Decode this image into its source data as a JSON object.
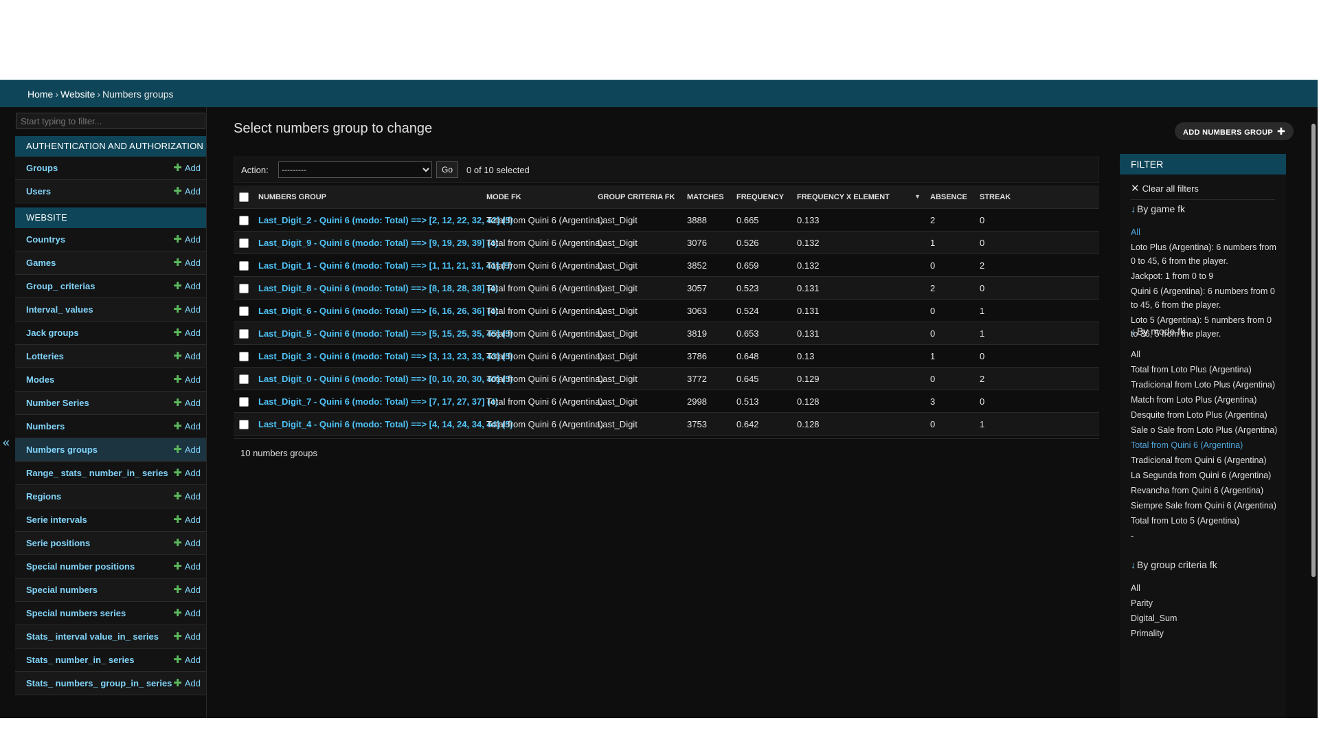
{
  "breadcrumbs": {
    "home": "Home",
    "website": "Website",
    "current": "Numbers groups",
    "sep": "›"
  },
  "sidebar": {
    "filter_placeholder": "Start typing to filter...",
    "modules": [
      {
        "caption": "AUTHENTICATION AND AUTHORIZATION",
        "items": [
          {
            "label": "Groups",
            "add": "Add"
          },
          {
            "label": "Users",
            "add": "Add"
          }
        ]
      },
      {
        "caption": "WEBSITE",
        "items": [
          {
            "label": "Countrys",
            "add": "Add"
          },
          {
            "label": "Games",
            "add": "Add"
          },
          {
            "label": "Group_ criterias",
            "add": "Add"
          },
          {
            "label": "Interval_ values",
            "add": "Add"
          },
          {
            "label": "Jack groups",
            "add": "Add"
          },
          {
            "label": "Lotteries",
            "add": "Add"
          },
          {
            "label": "Modes",
            "add": "Add"
          },
          {
            "label": "Number Series",
            "add": "Add"
          },
          {
            "label": "Numbers",
            "add": "Add"
          },
          {
            "label": "Numbers groups",
            "add": "Add"
          },
          {
            "label": "Range_ stats_ number_in_ series",
            "add": "Add"
          },
          {
            "label": "Regions",
            "add": "Add"
          },
          {
            "label": "Serie intervals",
            "add": "Add"
          },
          {
            "label": "Serie positions",
            "add": "Add"
          },
          {
            "label": "Special number positions",
            "add": "Add"
          },
          {
            "label": "Special numbers",
            "add": "Add"
          },
          {
            "label": "Special numbers series",
            "add": "Add"
          },
          {
            "label": "Stats_ interval value_in_ series",
            "add": "Add"
          },
          {
            "label": "Stats_ number_in_ series",
            "add": "Add"
          },
          {
            "label": "Stats_ numbers_ group_in_ series",
            "add": "Add"
          }
        ]
      }
    ]
  },
  "main": {
    "title": "Select numbers group to change",
    "add_button": "ADD NUMBERS GROUP",
    "action_label": "Action:",
    "action_selected": "---------",
    "go_label": "Go",
    "selected_counter": "0 of 10 selected",
    "columns": [
      "NUMBERS GROUP",
      "MODE FK",
      "GROUP CRITERIA FK",
      "MATCHES",
      "FREQUENCY",
      "FREQUENCY X ELEMENT",
      "ABSENCE",
      "STREAK"
    ],
    "rows": [
      [
        "Last_Digit_2 - Quini 6 (modo: Total) ==> [2, 12, 22, 32, 42] (5)",
        "Total from Quini 6 (Argentina)",
        "Last_Digit",
        "3888",
        "0.665",
        "0.133",
        "2",
        "0"
      ],
      [
        "Last_Digit_9 - Quini 6 (modo: Total) ==> [9, 19, 29, 39] (4)",
        "Total from Quini 6 (Argentina)",
        "Last_Digit",
        "3076",
        "0.526",
        "0.132",
        "1",
        "0"
      ],
      [
        "Last_Digit_1 - Quini 6 (modo: Total) ==> [1, 11, 21, 31, 41] (5)",
        "Total from Quini 6 (Argentina)",
        "Last_Digit",
        "3852",
        "0.659",
        "0.132",
        "0",
        "2"
      ],
      [
        "Last_Digit_8 - Quini 6 (modo: Total) ==> [8, 18, 28, 38] (4)",
        "Total from Quini 6 (Argentina)",
        "Last_Digit",
        "3057",
        "0.523",
        "0.131",
        "2",
        "0"
      ],
      [
        "Last_Digit_6 - Quini 6 (modo: Total) ==> [6, 16, 26, 36] (4)",
        "Total from Quini 6 (Argentina)",
        "Last_Digit",
        "3063",
        "0.524",
        "0.131",
        "0",
        "1"
      ],
      [
        "Last_Digit_5 - Quini 6 (modo: Total) ==> [5, 15, 25, 35, 45] (5)",
        "Total from Quini 6 (Argentina)",
        "Last_Digit",
        "3819",
        "0.653",
        "0.131",
        "0",
        "1"
      ],
      [
        "Last_Digit_3 - Quini 6 (modo: Total) ==> [3, 13, 23, 33, 43] (5)",
        "Total from Quini 6 (Argentina)",
        "Last_Digit",
        "3786",
        "0.648",
        "0.13",
        "1",
        "0"
      ],
      [
        "Last_Digit_0 - Quini 6 (modo: Total) ==> [0, 10, 20, 30, 40] (5)",
        "Total from Quini 6 (Argentina)",
        "Last_Digit",
        "3772",
        "0.645",
        "0.129",
        "0",
        "2"
      ],
      [
        "Last_Digit_7 - Quini 6 (modo: Total) ==> [7, 17, 27, 37] (4)",
        "Total from Quini 6 (Argentina)",
        "Last_Digit",
        "2998",
        "0.513",
        "0.128",
        "3",
        "0"
      ],
      [
        "Last_Digit_4 - Quini 6 (modo: Total) ==> [4, 14, 24, 34, 44] (5)",
        "Total from Quini 6 (Argentina)",
        "Last_Digit",
        "3753",
        "0.642",
        "0.128",
        "0",
        "1"
      ]
    ],
    "paginator": "10 numbers groups"
  },
  "filter": {
    "header": "FILTER",
    "clear": "Clear all filters",
    "arrow": "↓",
    "groups": [
      {
        "title": "By game fk",
        "items": [
          "All",
          "Loto Plus (Argentina): 6 numbers from 0 to 45, 6 from the player.",
          "Jackpot: 1 from 0 to 9",
          "Quini 6 (Argentina): 6 numbers from 0 to 45, 6 from the player.",
          "Loto 5 (Argentina): 5 numbers from 0 to 36, 5 from the player."
        ],
        "selected": 0
      },
      {
        "title": "By mode fk",
        "items": [
          "All",
          "Total from Loto Plus (Argentina)",
          "Tradicional from Loto Plus (Argentina)",
          "Match from Loto Plus (Argentina)",
          "Desquite from Loto Plus (Argentina)",
          "Sale o Sale from Loto Plus (Argentina)",
          "Total from Quini 6 (Argentina)",
          "Tradicional from Quini 6 (Argentina)",
          "La Segunda from Quini 6 (Argentina)",
          "Revancha from Quini 6 (Argentina)",
          "Siempre Sale from Quini 6 (Argentina)",
          "Total from Loto 5 (Argentina)",
          "-"
        ],
        "selected": 6
      },
      {
        "title": "By group criteria fk",
        "items": [
          "All",
          "Parity",
          "Digital_Sum",
          "Primality"
        ],
        "selected": -1
      }
    ]
  },
  "colors": {
    "accent": "#0f4558",
    "link": "#81d4fa",
    "add_plus": "#5cb85c",
    "background": "#0e0e0e"
  },
  "icons": {
    "collapse": "double-chevron-left-icon",
    "plus": "plus-icon",
    "clear": "close-icon",
    "sort": "caret-down-icon"
  }
}
